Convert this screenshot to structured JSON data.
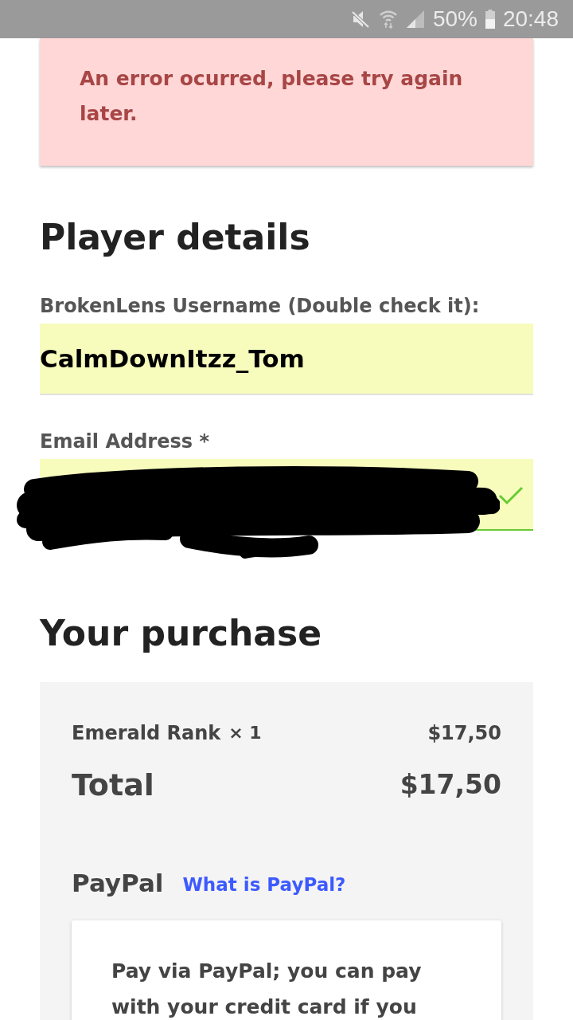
{
  "status_bar": {
    "battery_text": "50%",
    "time": "20:48"
  },
  "error_notice": {
    "message": "An error ocurred, please try again later."
  },
  "player_details": {
    "heading": "Player details",
    "fields": [
      {
        "label": "BrokenLens Username (Double check it):",
        "value": "CalmDownItzz_Tom",
        "valid": false,
        "redacted": false
      },
      {
        "label": "Email Address *",
        "valid": true,
        "redacted": true
      }
    ]
  },
  "purchase": {
    "heading": "Your purchase",
    "items": [
      {
        "name": "Emerald Rank",
        "quantity": "× 1",
        "price": "$17,50"
      }
    ],
    "total_label": "Total",
    "total": "$17,50",
    "payment": {
      "method": "PayPal",
      "link": "What is PayPal?",
      "description": "Pay via PayPal; you can pay with your credit card if you"
    }
  }
}
